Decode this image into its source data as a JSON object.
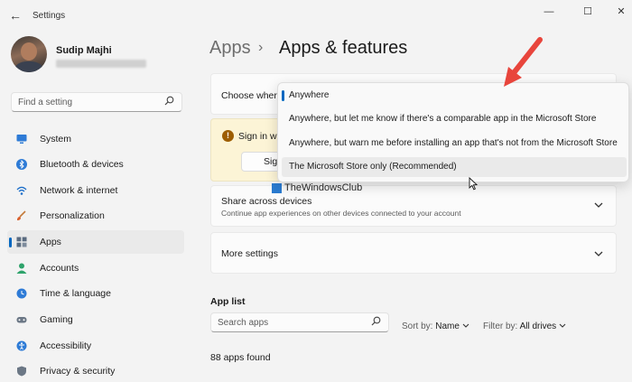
{
  "window": {
    "app_title": "Settings",
    "controls": {
      "minimize": "—",
      "maximize": "☐",
      "close": "✕"
    },
    "back_glyph": "←"
  },
  "profile": {
    "name": "Sudip Majhi"
  },
  "search": {
    "placeholder": "Find a setting"
  },
  "sidebar": {
    "items": [
      {
        "label": "System",
        "icon": "monitor-icon"
      },
      {
        "label": "Bluetooth & devices",
        "icon": "bluetooth-icon"
      },
      {
        "label": "Network & internet",
        "icon": "wifi-icon"
      },
      {
        "label": "Personalization",
        "icon": "brush-icon"
      },
      {
        "label": "Apps",
        "icon": "apps-icon",
        "active": true
      },
      {
        "label": "Accounts",
        "icon": "person-icon"
      },
      {
        "label": "Time & language",
        "icon": "globe-clock-icon"
      },
      {
        "label": "Gaming",
        "icon": "gamepad-icon"
      },
      {
        "label": "Accessibility",
        "icon": "accessibility-icon"
      },
      {
        "label": "Privacy & security",
        "icon": "shield-icon"
      }
    ]
  },
  "header": {
    "parent": "Apps",
    "separator": "›",
    "current": "Apps & features"
  },
  "cards": {
    "choose_where_label": "Choose where",
    "signin_text": "Sign in wi",
    "signin_button": "Sig",
    "share_title": "Share across devices",
    "share_desc": "Continue app experiences on other devices connected to your account",
    "more_settings": "More settings"
  },
  "dropdown": {
    "selected_index": 0,
    "hover_index": 3,
    "options": [
      "Anywhere",
      "Anywhere, but let me know if there's a comparable app in the Microsoft Store",
      "Anywhere, but warn me before installing an app that's not from the Microsoft Store",
      "The Microsoft Store only (Recommended)"
    ]
  },
  "watermark": {
    "text": "TheWindowsClub"
  },
  "app_list": {
    "title": "App list",
    "search_placeholder": "Search apps",
    "sort_label": "Sort by:",
    "sort_value": "Name",
    "filter_label": "Filter by:",
    "filter_value": "All drives",
    "found": "88 apps found"
  },
  "colors": {
    "accent": "#0067c0",
    "arrow": "#e8453c",
    "warning_bg": "#fcf4d6"
  }
}
